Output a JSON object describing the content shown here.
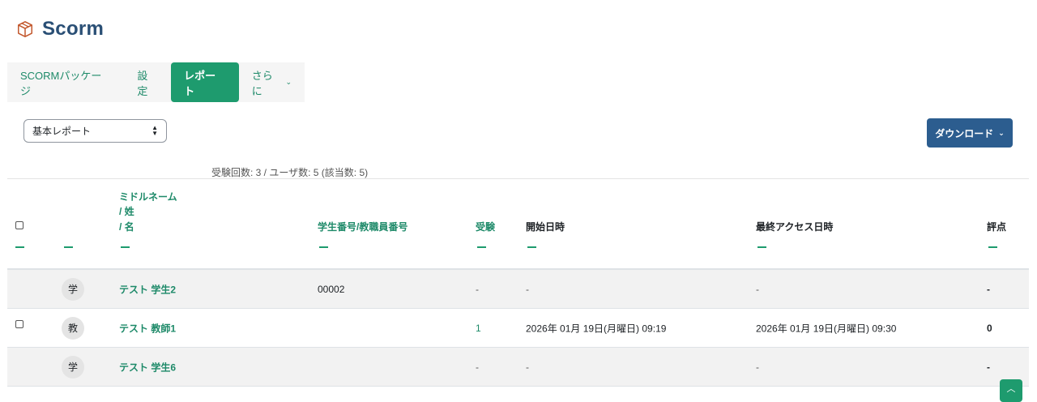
{
  "header": {
    "title": "Scorm",
    "icon": "package-icon",
    "icon_color": "#c2562b"
  },
  "secnav": {
    "tabs": [
      {
        "label": "SCORMパッケージ",
        "active": false
      },
      {
        "label": "設定",
        "active": false
      },
      {
        "label": "レポート",
        "active": true
      },
      {
        "label": "さらに",
        "active": false,
        "has_dropdown": true
      }
    ]
  },
  "report_select": {
    "value": "基本レポート"
  },
  "download": {
    "label": "ダウンロード"
  },
  "summary": "受験回数: 3 / ユーザ数: 5 (該当数: 5)",
  "table": {
    "headers": {
      "middle_name": "ミドルネーム",
      "last_name": "/ 姓",
      "first_name": "/ 名",
      "id_number": "学生番号/教職員番号",
      "attempt": "受験",
      "start": "開始日時",
      "last_access": "最終アクセス日時",
      "grade": "評点"
    },
    "rows": [
      {
        "avatar": "学",
        "name": "テスト 学生2",
        "id_number": "00002",
        "attempt": "-",
        "start": "-",
        "last_access": "-",
        "grade": "-",
        "has_checkbox": false
      },
      {
        "avatar": "教",
        "name": "テスト 教師1",
        "id_number": "",
        "attempt": "1",
        "start": "2026年 01月 19日(月曜日) 09:19",
        "last_access": "2026年 01月 19日(月曜日) 09:30",
        "grade": "0",
        "has_checkbox": true
      },
      {
        "avatar": "学",
        "name": "テスト 学生6",
        "id_number": "",
        "attempt": "-",
        "start": "-",
        "last_access": "-",
        "grade": "-",
        "has_checkbox": false
      }
    ]
  },
  "colors": {
    "accent": "#1e9b6e",
    "primary": "#2c5d8f",
    "title": "#2a4f75"
  }
}
